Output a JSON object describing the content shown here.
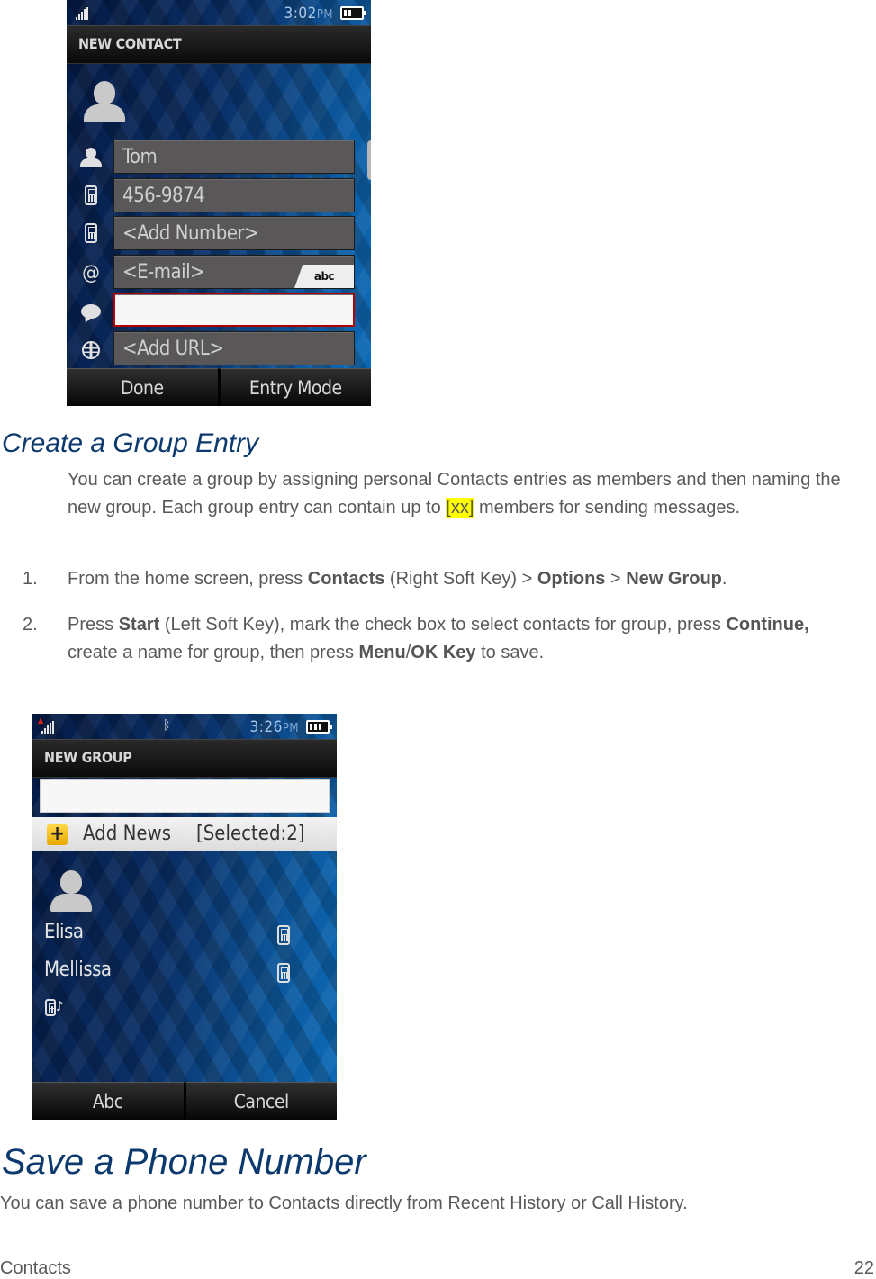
{
  "screen1": {
    "status": {
      "time": "3:02",
      "ampm": "PM"
    },
    "title": "NEW CONTACT",
    "fields": [
      {
        "icon": "person-icon",
        "value": "Tom"
      },
      {
        "icon": "mobile-phone-icon",
        "value": "456-9874"
      },
      {
        "icon": "mobile-phone-icon",
        "value": "<Add Number>"
      },
      {
        "icon": "at-sign-icon",
        "value": "<E-mail>"
      },
      {
        "icon": "speech-bubble-icon",
        "value": ""
      },
      {
        "icon": "globe-icon",
        "value": "<Add URL>"
      }
    ],
    "entry_mode_badge": "abc",
    "softkeys": {
      "left": "Done",
      "right": "Entry Mode"
    }
  },
  "group_section": {
    "heading": "Create a Group Entry",
    "intro_before": "You can create a group by assigning personal Contacts entries as members and then naming the new group. Each group entry can contain up to ",
    "intro_highlight": "[xx]",
    "intro_after": " members for sending messages.",
    "steps": [
      {
        "num": "1.",
        "parts": [
          {
            "t": "From the home screen, press ",
            "b": false
          },
          {
            "t": "Contacts",
            "b": true
          },
          {
            "t": " (Right Soft Key) > ",
            "b": false
          },
          {
            "t": "Options",
            "b": true
          },
          {
            "t": " > ",
            "b": false
          },
          {
            "t": "New Group",
            "b": true
          },
          {
            "t": ".",
            "b": false
          }
        ]
      },
      {
        "num": "2.",
        "parts": [
          {
            "t": "Press ",
            "b": false
          },
          {
            "t": "Start",
            "b": true
          },
          {
            "t": " (Left Soft Key), mark the check box to select contacts for group, press ",
            "b": false
          },
          {
            "t": "Continue,",
            "b": true
          },
          {
            "t": " create a name for group, then press ",
            "b": false
          },
          {
            "t": "Menu",
            "b": true
          },
          {
            "t": "/",
            "b": false
          },
          {
            "t": "OK Key",
            "b": true
          },
          {
            "t": " to save.",
            "b": false
          }
        ]
      }
    ]
  },
  "screen2": {
    "status": {
      "time": "3:26",
      "ampm": "PM"
    },
    "title": "NEW GROUP",
    "group_name_value": "",
    "add_label": "Add News",
    "selected_label": "[Selected:2]",
    "contacts": [
      {
        "name": "Elisa",
        "icon": "mobile-phone-icon"
      },
      {
        "name": "Mellissa",
        "icon": "mobile-phone-icon"
      }
    ],
    "softkeys": {
      "left": "Abc",
      "right": "Cancel"
    }
  },
  "save_section": {
    "heading": "Save a Phone Number",
    "text": "You can save a phone number to Contacts directly from Recent History or Call History."
  },
  "footer": {
    "section": "Contacts",
    "page": "22"
  }
}
